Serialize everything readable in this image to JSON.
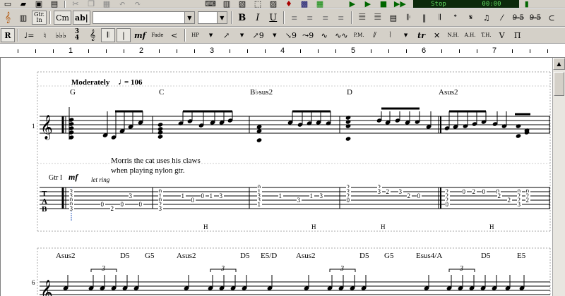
{
  "toolbar_top": {
    "lcd_left": "Stop",
    "lcd_right": "00:00"
  },
  "toolbar_main": {
    "gtr_in_label": "Gtr.\nIn",
    "chord_label": "Cm",
    "text_label": "ab|",
    "font_value": "",
    "size_value": "",
    "bold_label": "B",
    "italic_label": "I",
    "underline_label": "U",
    "right_label_1": "9-5",
    "right_label_2": "9-5"
  },
  "toolbar_notation": {
    "rest_label": "R",
    "fraction_top": "3",
    "fraction_bottom": "4",
    "dynamic_label": "mf",
    "fade_label": "Fade",
    "bend_label": "HP",
    "trill_label": "tr",
    "harmonic_1": "N.H.",
    "harmonic_2": "A.H.",
    "harmonic_3": "T.H.",
    "pm_label": "P.M."
  },
  "ruler": {
    "marks": [
      "1",
      "2",
      "3",
      "4",
      "5",
      "6",
      "7"
    ]
  },
  "score": {
    "tempo_text": "Moderately",
    "tempo_value": "= 106",
    "chords_row1": [
      "G",
      "C",
      "B♭sus2",
      "D",
      "Asus2"
    ],
    "annotation_line1": "Morris the cat uses his claws",
    "annotation_line2": "when playing nylon gtr.",
    "track_label": "Gtr I",
    "dynamic": "mf",
    "let_ring": "let ring",
    "system1_number": "1",
    "tab_letters": [
      "T",
      "A",
      "B"
    ],
    "hammer_labels": [
      "H",
      "H",
      "H",
      "H"
    ],
    "chords_row2": [
      "Asus2",
      "D5",
      "G5",
      "Asus2",
      "D5",
      "E5/D",
      "Asus2",
      "D5",
      "G5",
      "Esus4/A",
      "D5",
      "E5"
    ],
    "system2_number": "6",
    "triplet": "3"
  }
}
